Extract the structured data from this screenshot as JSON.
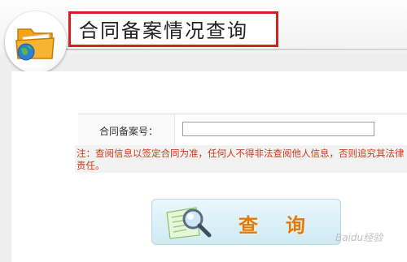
{
  "header": {
    "title": "合同备案情况查询",
    "logo_icon": "folder-globe-icon"
  },
  "form": {
    "contract_number_label": "合同备案号：",
    "contract_number_value": ""
  },
  "notice": {
    "text": "注：查阅信息以签定合同为准，任何人不得非法查阅他人信息，否则追究其法律责任。"
  },
  "query_button": {
    "char1": "查",
    "char2": "询",
    "icon": "magnifier-document-icon"
  },
  "watermark": {
    "text": "Baidu经验"
  },
  "colors": {
    "title_border": "#d42020",
    "notice_text": "#cc3a1a",
    "button_text": "#e07a10",
    "button_bg": "#cfeaf4"
  }
}
